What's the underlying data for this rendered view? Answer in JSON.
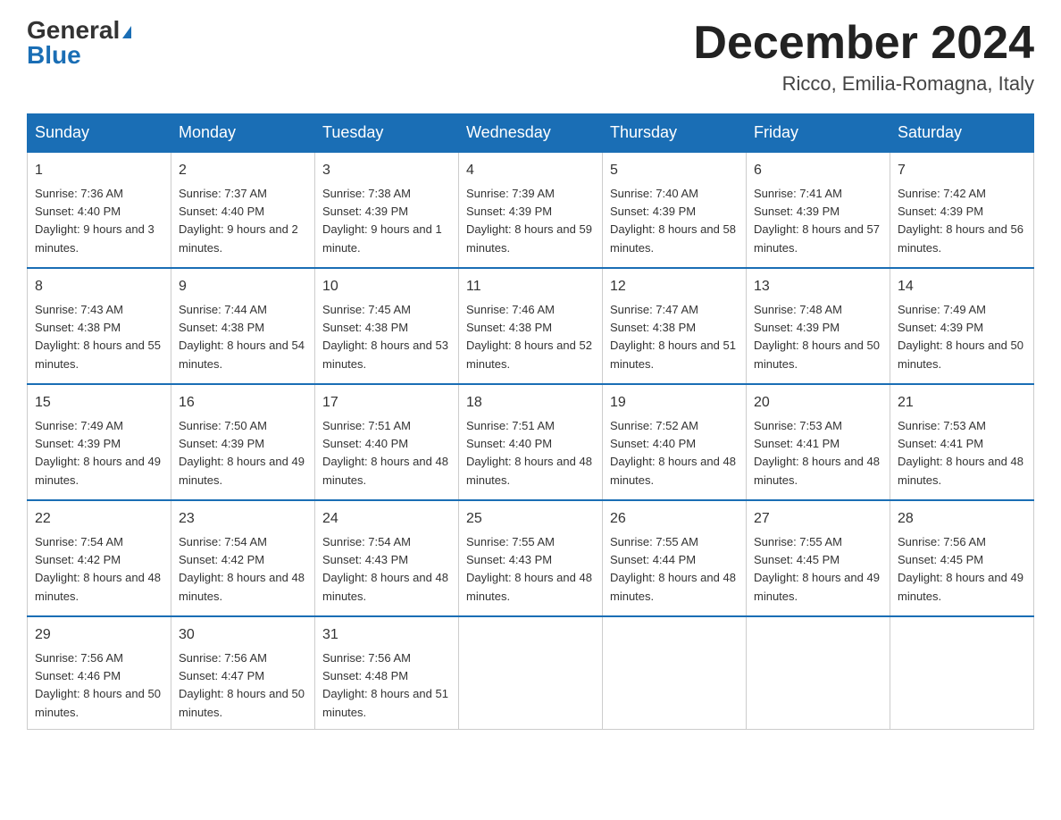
{
  "header": {
    "logo_line1": "General",
    "logo_line2": "Blue",
    "month_title": "December 2024",
    "location": "Ricco, Emilia-Romagna, Italy"
  },
  "days_of_week": [
    "Sunday",
    "Monday",
    "Tuesday",
    "Wednesday",
    "Thursday",
    "Friday",
    "Saturday"
  ],
  "weeks": [
    [
      {
        "day": "1",
        "sunrise": "7:36 AM",
        "sunset": "4:40 PM",
        "daylight": "9 hours and 3 minutes."
      },
      {
        "day": "2",
        "sunrise": "7:37 AM",
        "sunset": "4:40 PM",
        "daylight": "9 hours and 2 minutes."
      },
      {
        "day": "3",
        "sunrise": "7:38 AM",
        "sunset": "4:39 PM",
        "daylight": "9 hours and 1 minute."
      },
      {
        "day": "4",
        "sunrise": "7:39 AM",
        "sunset": "4:39 PM",
        "daylight": "8 hours and 59 minutes."
      },
      {
        "day": "5",
        "sunrise": "7:40 AM",
        "sunset": "4:39 PM",
        "daylight": "8 hours and 58 minutes."
      },
      {
        "day": "6",
        "sunrise": "7:41 AM",
        "sunset": "4:39 PM",
        "daylight": "8 hours and 57 minutes."
      },
      {
        "day": "7",
        "sunrise": "7:42 AM",
        "sunset": "4:39 PM",
        "daylight": "8 hours and 56 minutes."
      }
    ],
    [
      {
        "day": "8",
        "sunrise": "7:43 AM",
        "sunset": "4:38 PM",
        "daylight": "8 hours and 55 minutes."
      },
      {
        "day": "9",
        "sunrise": "7:44 AM",
        "sunset": "4:38 PM",
        "daylight": "8 hours and 54 minutes."
      },
      {
        "day": "10",
        "sunrise": "7:45 AM",
        "sunset": "4:38 PM",
        "daylight": "8 hours and 53 minutes."
      },
      {
        "day": "11",
        "sunrise": "7:46 AM",
        "sunset": "4:38 PM",
        "daylight": "8 hours and 52 minutes."
      },
      {
        "day": "12",
        "sunrise": "7:47 AM",
        "sunset": "4:38 PM",
        "daylight": "8 hours and 51 minutes."
      },
      {
        "day": "13",
        "sunrise": "7:48 AM",
        "sunset": "4:39 PM",
        "daylight": "8 hours and 50 minutes."
      },
      {
        "day": "14",
        "sunrise": "7:49 AM",
        "sunset": "4:39 PM",
        "daylight": "8 hours and 50 minutes."
      }
    ],
    [
      {
        "day": "15",
        "sunrise": "7:49 AM",
        "sunset": "4:39 PM",
        "daylight": "8 hours and 49 minutes."
      },
      {
        "day": "16",
        "sunrise": "7:50 AM",
        "sunset": "4:39 PM",
        "daylight": "8 hours and 49 minutes."
      },
      {
        "day": "17",
        "sunrise": "7:51 AM",
        "sunset": "4:40 PM",
        "daylight": "8 hours and 48 minutes."
      },
      {
        "day": "18",
        "sunrise": "7:51 AM",
        "sunset": "4:40 PM",
        "daylight": "8 hours and 48 minutes."
      },
      {
        "day": "19",
        "sunrise": "7:52 AM",
        "sunset": "4:40 PM",
        "daylight": "8 hours and 48 minutes."
      },
      {
        "day": "20",
        "sunrise": "7:53 AM",
        "sunset": "4:41 PM",
        "daylight": "8 hours and 48 minutes."
      },
      {
        "day": "21",
        "sunrise": "7:53 AM",
        "sunset": "4:41 PM",
        "daylight": "8 hours and 48 minutes."
      }
    ],
    [
      {
        "day": "22",
        "sunrise": "7:54 AM",
        "sunset": "4:42 PM",
        "daylight": "8 hours and 48 minutes."
      },
      {
        "day": "23",
        "sunrise": "7:54 AM",
        "sunset": "4:42 PM",
        "daylight": "8 hours and 48 minutes."
      },
      {
        "day": "24",
        "sunrise": "7:54 AM",
        "sunset": "4:43 PM",
        "daylight": "8 hours and 48 minutes."
      },
      {
        "day": "25",
        "sunrise": "7:55 AM",
        "sunset": "4:43 PM",
        "daylight": "8 hours and 48 minutes."
      },
      {
        "day": "26",
        "sunrise": "7:55 AM",
        "sunset": "4:44 PM",
        "daylight": "8 hours and 48 minutes."
      },
      {
        "day": "27",
        "sunrise": "7:55 AM",
        "sunset": "4:45 PM",
        "daylight": "8 hours and 49 minutes."
      },
      {
        "day": "28",
        "sunrise": "7:56 AM",
        "sunset": "4:45 PM",
        "daylight": "8 hours and 49 minutes."
      }
    ],
    [
      {
        "day": "29",
        "sunrise": "7:56 AM",
        "sunset": "4:46 PM",
        "daylight": "8 hours and 50 minutes."
      },
      {
        "day": "30",
        "sunrise": "7:56 AM",
        "sunset": "4:47 PM",
        "daylight": "8 hours and 50 minutes."
      },
      {
        "day": "31",
        "sunrise": "7:56 AM",
        "sunset": "4:48 PM",
        "daylight": "8 hours and 51 minutes."
      },
      null,
      null,
      null,
      null
    ]
  ]
}
